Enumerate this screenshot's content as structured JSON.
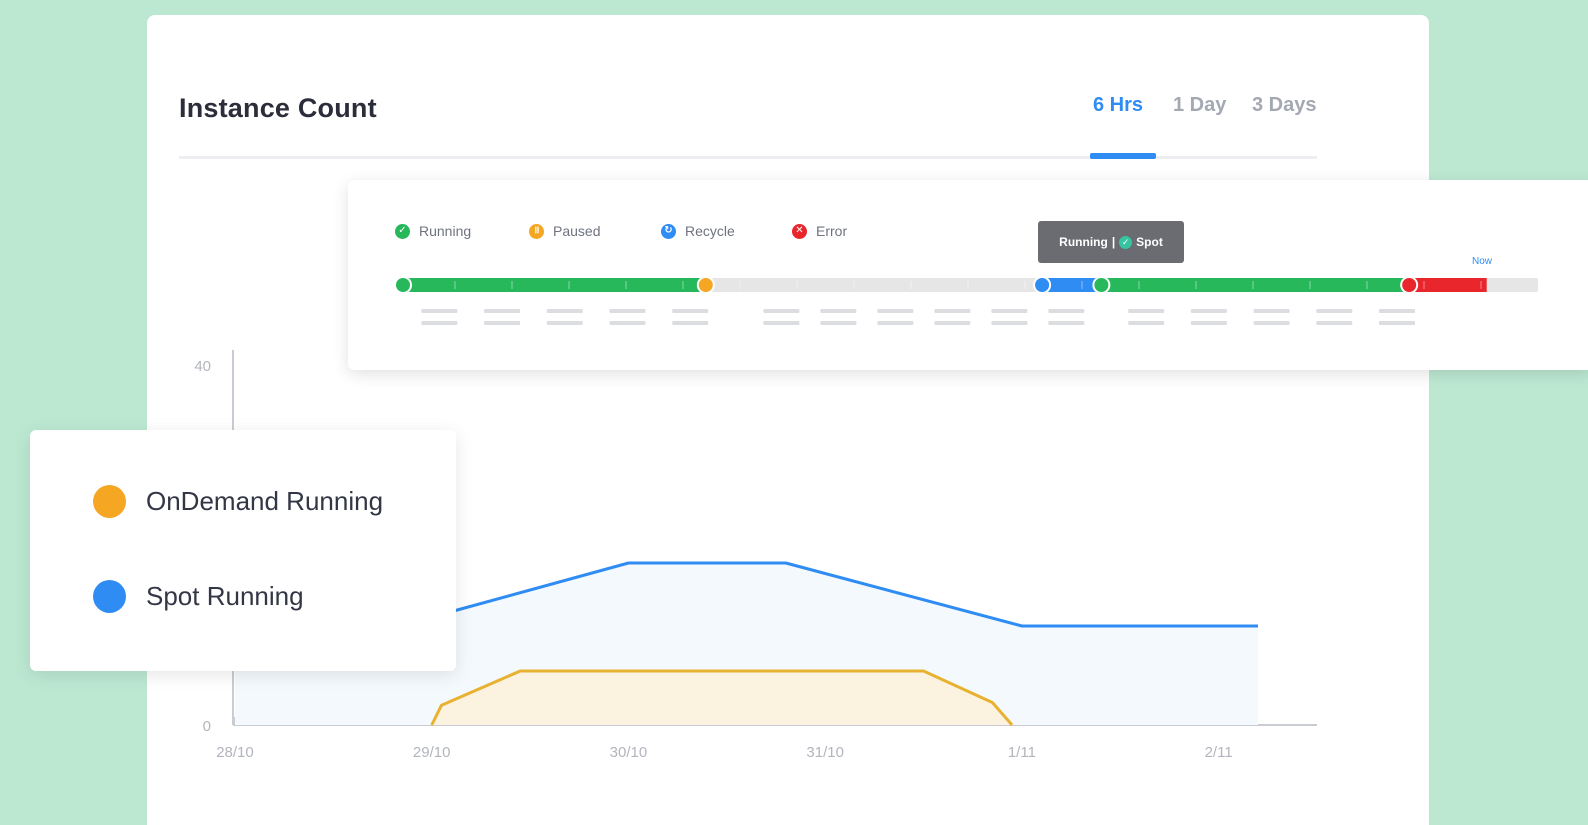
{
  "panel": {
    "title": "Instance Count",
    "tabs": [
      {
        "label": "6 Hrs",
        "active": true
      },
      {
        "label": "1 Day",
        "active": false
      },
      {
        "label": "3 Days",
        "active": false
      }
    ]
  },
  "status_timeline": {
    "legend": [
      {
        "label": "Running",
        "color": "#27b85c",
        "icon": "check-icon"
      },
      {
        "label": "Paused",
        "color": "#f5a623",
        "icon": "pause-icon"
      },
      {
        "label": "Recycle",
        "color": "#2f8cf3",
        "icon": "recycle-icon"
      },
      {
        "label": "Error",
        "color": "#e8262b",
        "icon": "close-icon"
      }
    ],
    "tooltip": {
      "state": "Running",
      "type": "Spot"
    },
    "now_label": "Now",
    "segments": [
      {
        "status": "Running",
        "start": 0.0,
        "end": 0.27
      },
      {
        "status": "Paused",
        "start": 0.27,
        "end": 0.565
      },
      {
        "status": "Recycle",
        "start": 0.565,
        "end": 0.617
      },
      {
        "status": "Running",
        "start": 0.617,
        "end": 0.887
      },
      {
        "status": "Error",
        "start": 0.887,
        "end": 0.955
      }
    ]
  },
  "series_legend": [
    {
      "label": "OnDemand Running",
      "color": "#f5a623"
    },
    {
      "label": "Spot Running",
      "color": "#2f8cf3"
    }
  ],
  "chart_data": {
    "type": "line",
    "x_ticks": [
      "28/10",
      "29/10",
      "30/10",
      "31/10",
      "1/11",
      "2/11"
    ],
    "y_ticks": [
      "0",
      "40"
    ],
    "ylim": [
      0,
      40
    ],
    "series": [
      {
        "name": "Spot Running",
        "color": "#2f8cf3",
        "x": [
          28.0,
          29.0,
          30.0,
          30.8,
          32.0,
          33.2
        ],
        "y": [
          12,
          12,
          18,
          18,
          11,
          11
        ]
      },
      {
        "name": "OnDemand Running",
        "color": "#e8b230",
        "x": [
          29.0,
          29.05,
          29.45,
          31.5,
          31.85,
          31.95
        ],
        "y": [
          0,
          2.2,
          6,
          6,
          2.5,
          0
        ]
      }
    ]
  }
}
